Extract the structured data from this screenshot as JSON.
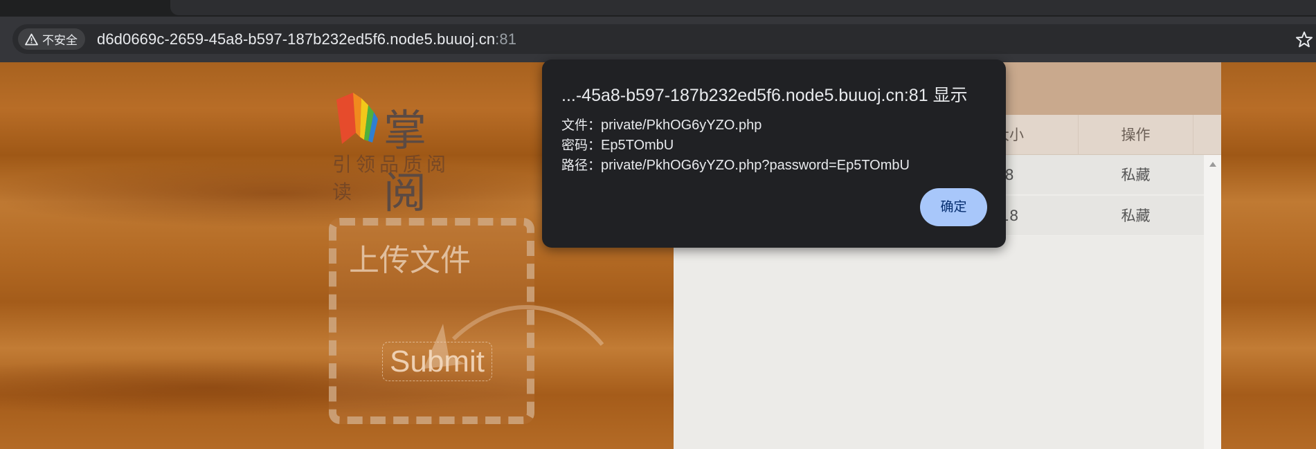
{
  "browser": {
    "security_chip": {
      "icon": "warning-triangle-icon",
      "label": "不安全"
    },
    "url": "d6d0669c-2659-45a8-b597-187b232ed5f6.node5.buuoj.cn",
    "port": ":81",
    "bookmark_icon": "star-icon"
  },
  "page": {
    "logo": {
      "title": "掌阅",
      "slogan": "引领品质阅读"
    },
    "upload": {
      "title": "上传文件",
      "submit_label": "Submit"
    },
    "table": {
      "columns": [
        {
          "label": "大小"
        },
        {
          "label": "操作"
        }
      ],
      "rows": [
        {
          "size": "8",
          "action": "私藏"
        },
        {
          "size": "18",
          "action": "私藏"
        }
      ]
    }
  },
  "dialog": {
    "title": "...-45a8-b597-187b232ed5f6.node5.buuoj.cn:81",
    "title_suffix": "显示",
    "lines": [
      {
        "key": "文件：",
        "value": "private/PkhOG6yYZO.php"
      },
      {
        "key": "密码：",
        "value": "Ep5TOmbU"
      },
      {
        "key": "路径：",
        "value": "private/PkhOG6yYZO.php?password=Ep5TOmbU"
      }
    ],
    "ok_label": "确定"
  },
  "colors": {
    "accent_button": "#a8c7fa",
    "dialog_bg": "#202124",
    "toolbar_bg": "#35363a"
  }
}
